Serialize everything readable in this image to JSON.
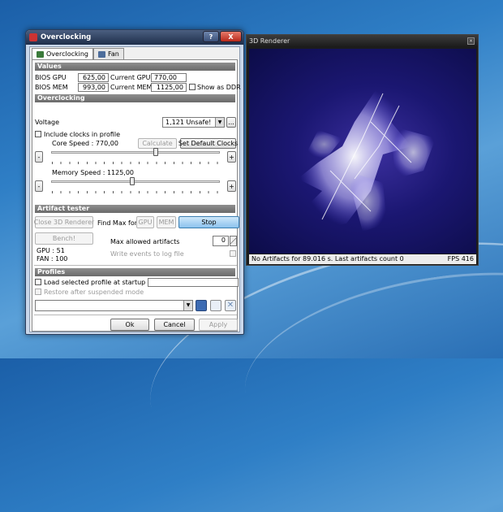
{
  "overclock_window": {
    "title": "Overclocking",
    "help_btn": "?",
    "close_btn": "X",
    "tabs": [
      {
        "label": "Overclocking"
      },
      {
        "label": "Fan"
      }
    ],
    "values": {
      "header": "Values",
      "bios_gpu_label": "BIOS GPU",
      "bios_gpu": "625,00",
      "current_gpu_label": "Current GPU",
      "current_gpu": "770,00",
      "bios_mem_label": "BIOS MEM",
      "bios_mem": "993,00",
      "current_mem_label": "Current MEM",
      "current_mem": "1125,00",
      "show_ddr": "Show as DDR"
    },
    "overclocking": {
      "header": "Overclocking",
      "voltage_label": "Voltage",
      "voltage_value": "1,121 Unsafe!",
      "more_btn": "...",
      "include_clocks": "Include clocks in profile",
      "core_speed": "Core Speed : 770,00",
      "calculate_btn": "Calculate",
      "set_default_btn": "Set Default Clocks",
      "minus": "-",
      "plus": "+",
      "memory_speed": "Memory Speed : 1125,00",
      "core_slider_fraction": 0.62,
      "mem_slider_fraction": 0.48
    },
    "artifact": {
      "header": "Artifact tester",
      "close_3d_btn": "Close 3D Renderer",
      "find_max_label": "Find Max for",
      "gpu_btn": "GPU",
      "mem_btn": "MEM",
      "stop_btn": "Stop",
      "bench_btn": "Bench!",
      "gpu_value": "GPU : 51",
      "fan_value": "FAN : 100",
      "max_artifacts_label": "Max allowed artifacts",
      "max_artifacts_value": "0",
      "write_events": "Write events to log file"
    },
    "profiles": {
      "header": "Profiles",
      "load_selected": "Load selected profile at startup",
      "restore": "Restore after suspended mode"
    },
    "footer": {
      "ok": "Ok",
      "cancel": "Cancel",
      "apply": "Apply"
    }
  },
  "renderer_window": {
    "title": "3D Renderer",
    "status_left": "No Artifacts for 89.016 s. Last artifacts count 0",
    "status_right": "FPS 416"
  }
}
